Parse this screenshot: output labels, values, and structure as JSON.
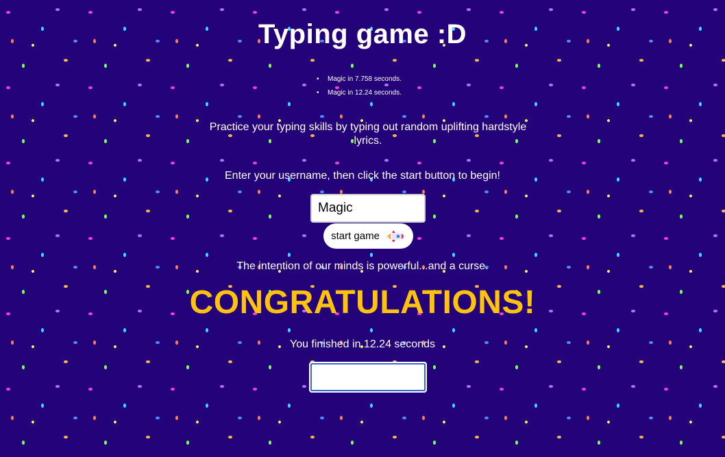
{
  "header": {
    "title": "Typing game :D"
  },
  "scores": [
    "Magic in 7.758 seconds.",
    "Magic in 12.24 seconds."
  ],
  "intro": {
    "text": "Practice your typing skills by typing out random uplifting hardstyle lyrics."
  },
  "start_section": {
    "prompt": "Enter your username, then click the start button to begin!",
    "username_value": "Magic",
    "start_label": "start game",
    "start_icon": "rocket-icon"
  },
  "game": {
    "quote": "The intention of our minds is powerful...and a curse.",
    "congrats": "CONGRATULATIONS!",
    "finished_text": "You finished in 12.24 seconds",
    "typing_value": ""
  },
  "colors": {
    "background": "#24037a",
    "congrats": "#ffc20e",
    "text": "#ffffff"
  }
}
